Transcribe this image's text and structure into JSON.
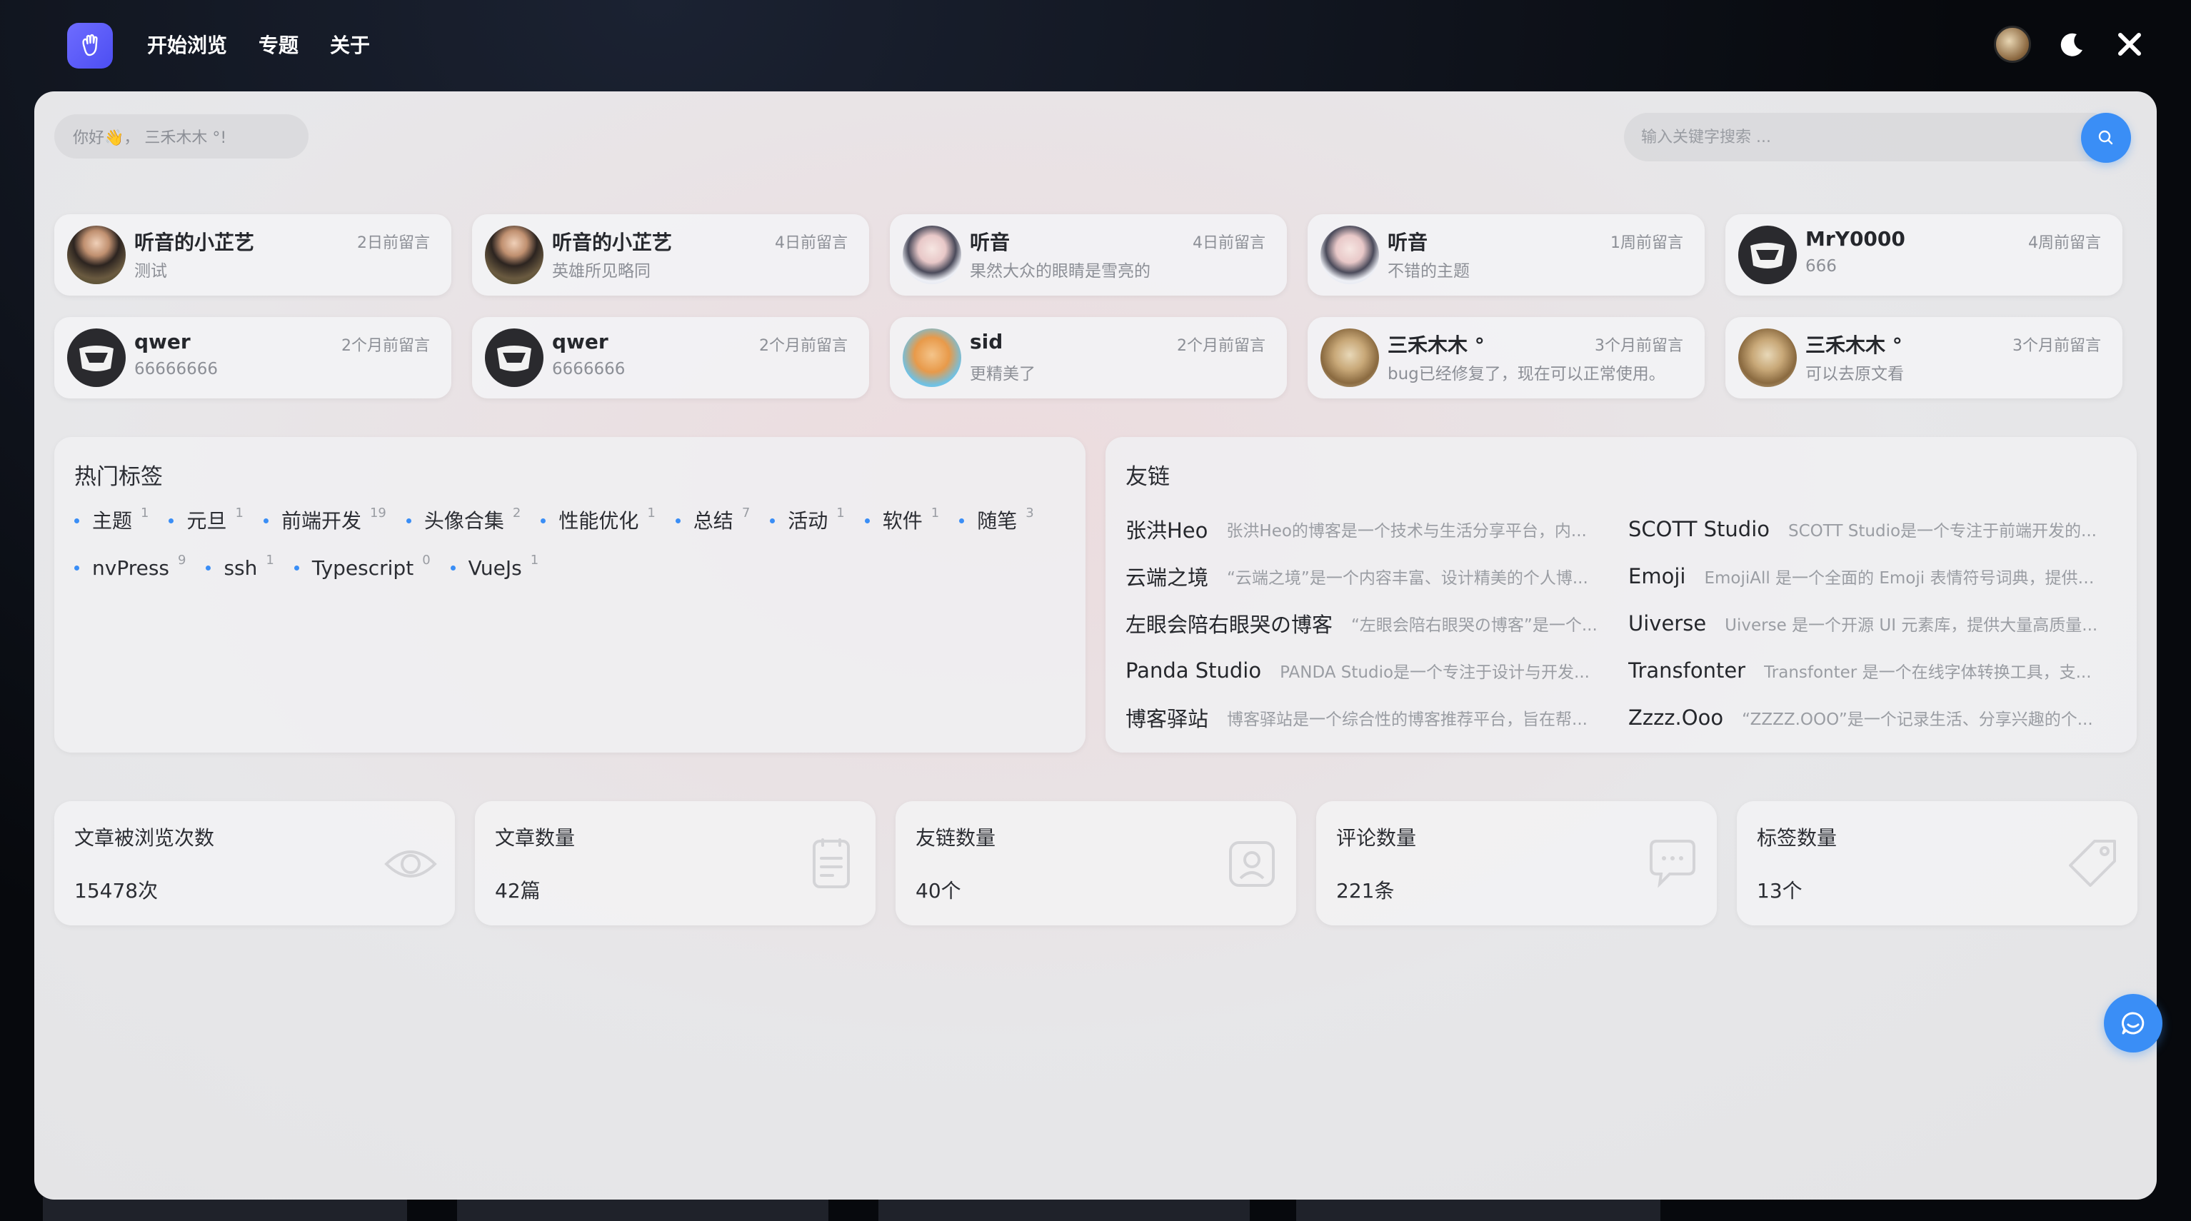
{
  "nav": {
    "links": [
      "开始浏览",
      "专题",
      "关于"
    ]
  },
  "greeting": "你好👋，  三禾木木 °! ",
  "search": {
    "placeholder": "输入关键字搜索 ..."
  },
  "comments": [
    {
      "name": "听音的小芷艺",
      "time": "2日前留言",
      "text": "测试",
      "avatar": "girl-avatar"
    },
    {
      "name": "听音的小芷艺",
      "time": "4日前留言",
      "text": "英雄所见略同",
      "avatar": "girl-avatar"
    },
    {
      "name": "听音",
      "time": "4日前留言",
      "text": "果然大众的眼睛是雪亮的",
      "avatar": "boy-avatar"
    },
    {
      "name": "听音",
      "time": "1周前留言",
      "text": "不错的主题",
      "avatar": "boy-avatar"
    },
    {
      "name": "MrY0000",
      "time": "4周前留言",
      "text": "666",
      "avatar": "mask-avatar"
    },
    {
      "name": "qwer",
      "time": "2个月前留言",
      "text": "66666666",
      "avatar": "mask-avatar"
    },
    {
      "name": "qwer",
      "time": "2个月前留言",
      "text": "6666666",
      "avatar": "mask-avatar"
    },
    {
      "name": "sid",
      "time": "2个月前留言",
      "text": "更精美了",
      "avatar": "cartoon-avatar"
    },
    {
      "name": "三禾木木 °",
      "time": "3个月前留言",
      "text": "bug已经修复了，现在可以正常使用。",
      "avatar": "cat-avatar"
    },
    {
      "name": "三禾木木 °",
      "time": "3个月前留言",
      "text": "可以去原文看",
      "avatar": "cat-avatar"
    }
  ],
  "tags": {
    "title": "热门标签",
    "items": [
      {
        "name": "主题",
        "count": "1"
      },
      {
        "name": "元旦",
        "count": "1"
      },
      {
        "name": "前端开发",
        "count": "19"
      },
      {
        "name": "头像合集",
        "count": "2"
      },
      {
        "name": "性能优化",
        "count": "1"
      },
      {
        "name": "总结",
        "count": "7"
      },
      {
        "name": "活动",
        "count": "1"
      },
      {
        "name": "软件",
        "count": "1"
      },
      {
        "name": "随笔",
        "count": "3"
      },
      {
        "name": "nvPress",
        "count": "9"
      },
      {
        "name": "ssh",
        "count": "1"
      },
      {
        "name": "Typescript",
        "count": "0"
      },
      {
        "name": "VueJs",
        "count": "1"
      }
    ]
  },
  "links": {
    "title": "友链",
    "items": [
      {
        "name": "张洪Heo",
        "desc": "张洪Heo的博客是一个技术与生活分享平台，内..."
      },
      {
        "name": "SCOTT Studio",
        "desc": "SCOTT Studio是一个专注于前端开发的..."
      },
      {
        "name": "云端之境",
        "desc": "“云端之境”是一个内容丰富、设计精美的个人博..."
      },
      {
        "name": "Emoji",
        "desc": "EmojiAll 是一个全面的 Emoji 表情符号词典，提供丰..."
      },
      {
        "name": "左眼会陪右眼哭の博客",
        "desc": "“左眼会陪右眼哭の博客”是一个..."
      },
      {
        "name": "Uiverse",
        "desc": "Uiverse 是一个开源 UI 元素库，提供大量高质量..."
      },
      {
        "name": "Panda Studio",
        "desc": "PANDA Studio是一个专注于设计与开发..."
      },
      {
        "name": "Transfonter",
        "desc": "Transfonter 是一个在线字体转换工具，支..."
      },
      {
        "name": "博客驿站",
        "desc": "博客驿站是一个综合性的博客推荐平台，旨在帮..."
      },
      {
        "name": "Zzzz.Ooo",
        "desc": "“ZZZZ.OOO”是一个记录生活、分享兴趣的个..."
      }
    ]
  },
  "stats": [
    {
      "label": "文章被浏览次数",
      "value": "15478次",
      "icon": "eye-icon"
    },
    {
      "label": "文章数量",
      "value": "42篇",
      "icon": "document-icon"
    },
    {
      "label": "友链数量",
      "value": "40个",
      "icon": "friend-link-icon"
    },
    {
      "label": "评论数量",
      "value": "221条",
      "icon": "comment-icon"
    },
    {
      "label": "标签数量",
      "value": "13个",
      "icon": "tag-icon"
    }
  ],
  "colors": {
    "accent": "#3a8ef6",
    "logo": "#5b5cf6"
  }
}
